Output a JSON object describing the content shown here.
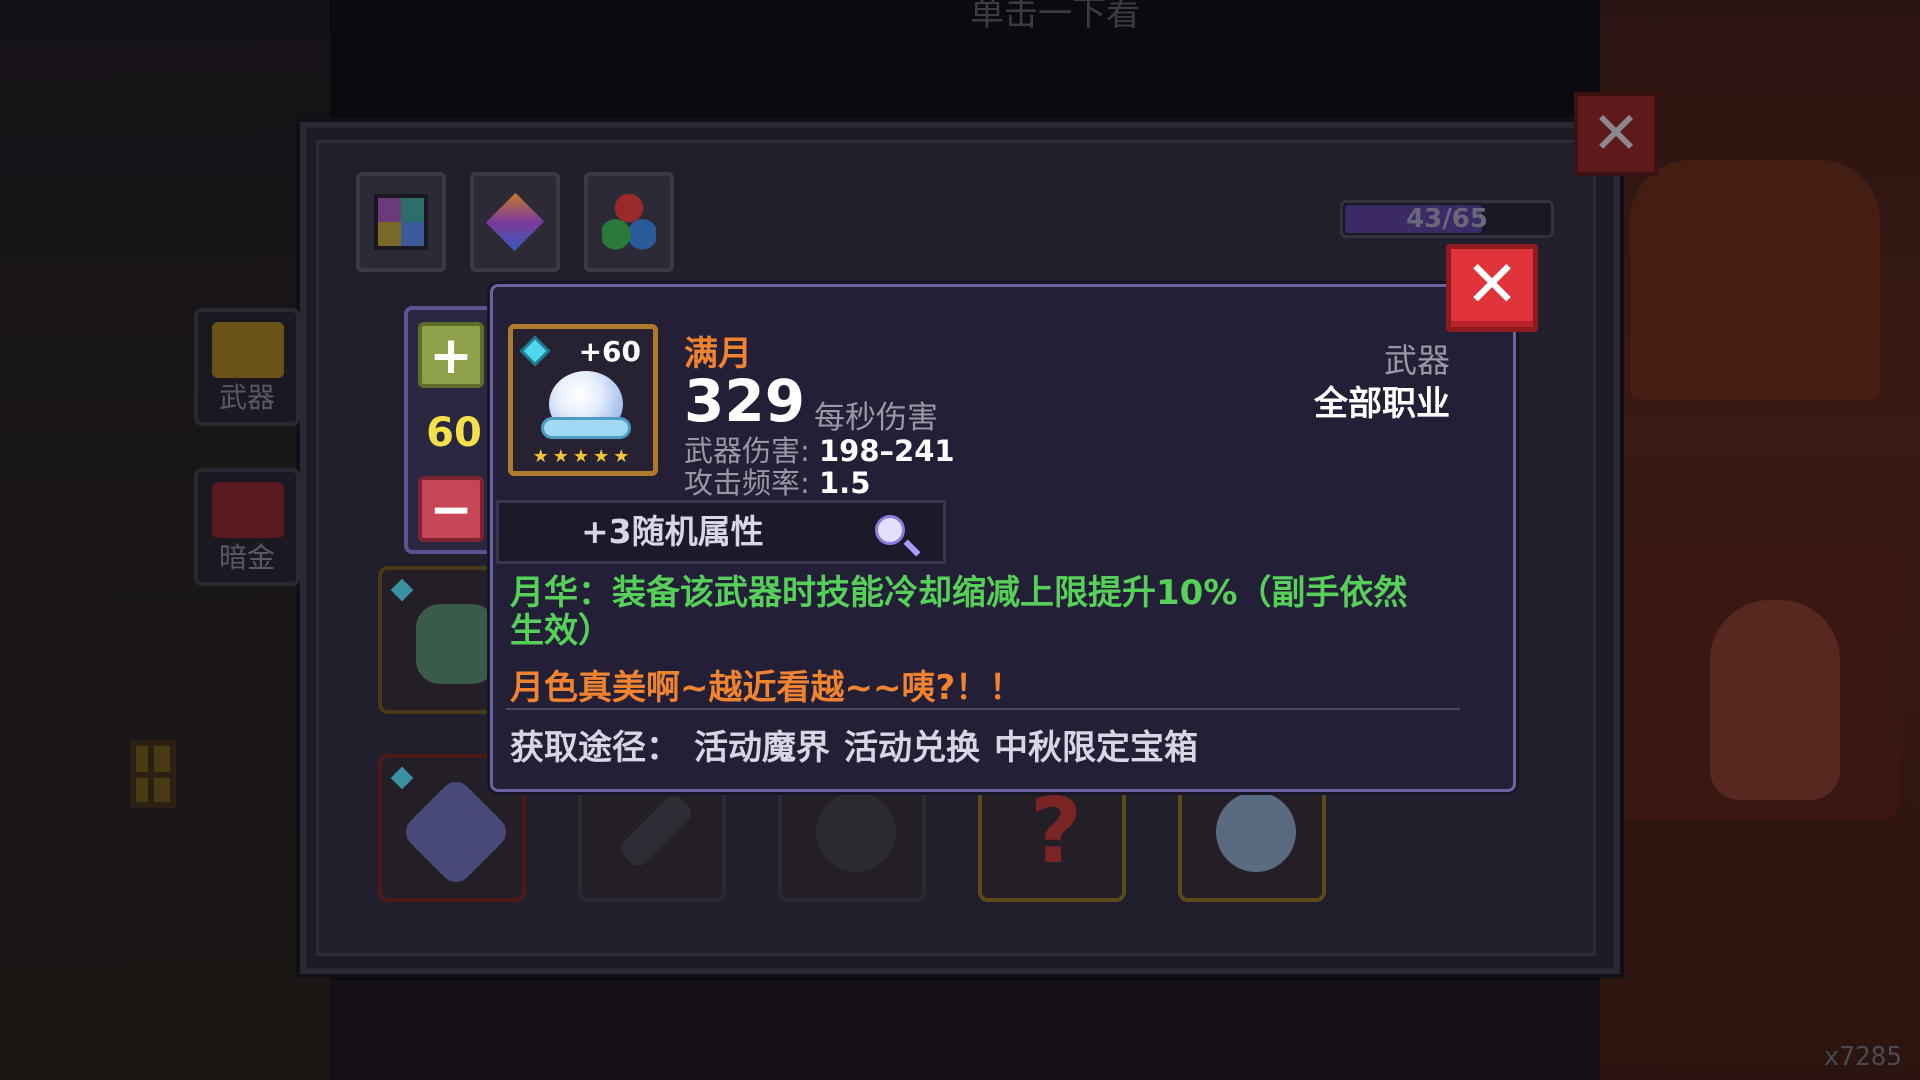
{
  "background": {
    "title": "单击一下看",
    "score": "x7285"
  },
  "inventory": {
    "progress_text": "43/65",
    "progress_value": 0.66,
    "side_tabs": [
      {
        "label": "武器",
        "icon": "weapon-chest-icon"
      },
      {
        "label": "暗金",
        "icon": "dark-gold-chest-icon"
      }
    ],
    "top_tabs": [
      "grid-icon",
      "diamond-icon",
      "gems-icon"
    ],
    "stepper": {
      "value": "60",
      "plus": "+",
      "minus": "−"
    },
    "close": "✕"
  },
  "tooltip": {
    "close": "✕",
    "weapon": {
      "name": "满月",
      "enhance": "+60",
      "stars": "★★★★★",
      "dps": "329",
      "dps_label": "每秒伤害",
      "damage_label": "武器伤害:",
      "damage_value": "198–241",
      "rate_label": "攻击频率:",
      "rate_value": "1.5",
      "category": "武器",
      "class": "全部职业"
    },
    "random_attr": "+3随机属性",
    "skill_text": "月华：装备该武器时技能冷却缩减上限提升10%（副手依然生效）",
    "flavor_text": "月色真美啊~越近看越~~咦?！！",
    "source_label": "获取途径：",
    "sources": [
      "活动魔界",
      "活动兑换",
      "中秋限定宝箱"
    ]
  },
  "colors": {
    "accent_orange": "#f0832f",
    "skill_green": "#57d05a",
    "close_red": "#e0343a",
    "frame_purple": "#6b63a0"
  }
}
